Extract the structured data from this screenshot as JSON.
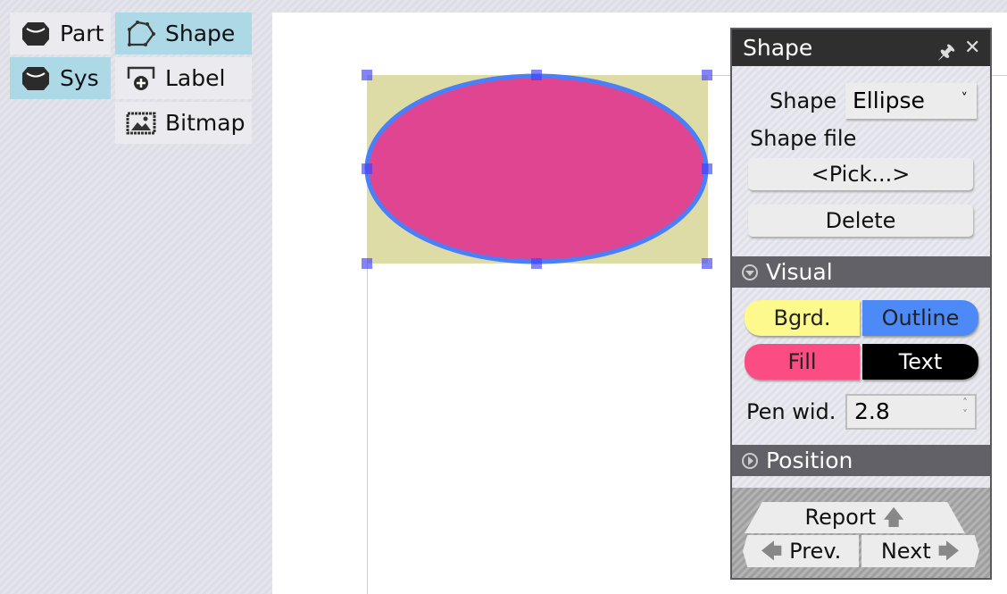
{
  "toolbox": {
    "items": [
      {
        "label": "Part",
        "icon": "part-icon",
        "active": false
      },
      {
        "label": "Shape",
        "icon": "shape-polygon-icon",
        "active": true
      },
      {
        "label": "Sys",
        "icon": "sys-icon",
        "active": true
      },
      {
        "label": "Label",
        "icon": "label-add-icon",
        "active": false
      },
      {
        "label": "Bitmap",
        "icon": "bitmap-icon",
        "active": false
      }
    ]
  },
  "canvas": {
    "shape": {
      "type": "Ellipse",
      "fill_color": "#df4590",
      "outline_color": "#4a7ffa",
      "background_color": "#dedca6",
      "handle_color": "#7b7bfb"
    }
  },
  "panel": {
    "title": "Shape",
    "pin_icon": "pin-icon",
    "close_icon": "close-icon",
    "shape_label": "Shape",
    "shape_value": "Ellipse",
    "shape_file_label": "Shape file",
    "pick_label": "<Pick...>",
    "delete_label": "Delete",
    "visual_section": "Visual",
    "colors": {
      "bgrd": {
        "label": "Bgrd.",
        "color": "#fdf98d"
      },
      "outline": {
        "label": "Outline",
        "color": "#4d8af7"
      },
      "fill": {
        "label": "Fill",
        "color": "#fb4c83"
      },
      "text": {
        "label": "Text",
        "color": "#000000"
      }
    },
    "pen_width_label": "Pen wid.",
    "pen_width_value": "2.8",
    "position_section": "Position",
    "report_label": "Report",
    "prev_label": "Prev.",
    "next_label": "Next"
  }
}
